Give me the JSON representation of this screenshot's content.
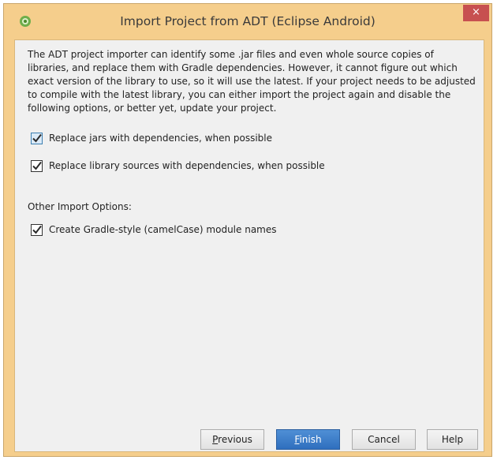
{
  "window": {
    "title": "Import Project from ADT (Eclipse Android)",
    "close_symbol": "×",
    "icon": "android-studio-icon"
  },
  "description": "The ADT project importer can identify some .jar files and even whole source copies of libraries, and replace them with Gradle dependencies. However, it cannot figure out which exact version of the library to use, so it will use the latest. If your project needs to be adjusted to compile with the latest library, you can either import the project again and disable the following options, or better yet, update your project.",
  "options": [
    {
      "label": "Replace jars with dependencies, when possible",
      "checked": true
    },
    {
      "label": "Replace library sources with dependencies, when possible",
      "checked": true
    }
  ],
  "other_options": {
    "heading": "Other Import Options:",
    "items": [
      {
        "label": "Create Gradle-style (camelCase) module names",
        "checked": true
      }
    ]
  },
  "buttons": {
    "previous": {
      "mnemonic": "P",
      "rest": "revious"
    },
    "finish": {
      "mnemonic": "F",
      "rest": "inish"
    },
    "cancel": "Cancel",
    "help": "Help"
  },
  "colors": {
    "title_bar": "#f5ce8c",
    "close_button": "#c75050",
    "primary_button": "#3a7ccb",
    "focus_checkbox": "#3c7fb1"
  }
}
